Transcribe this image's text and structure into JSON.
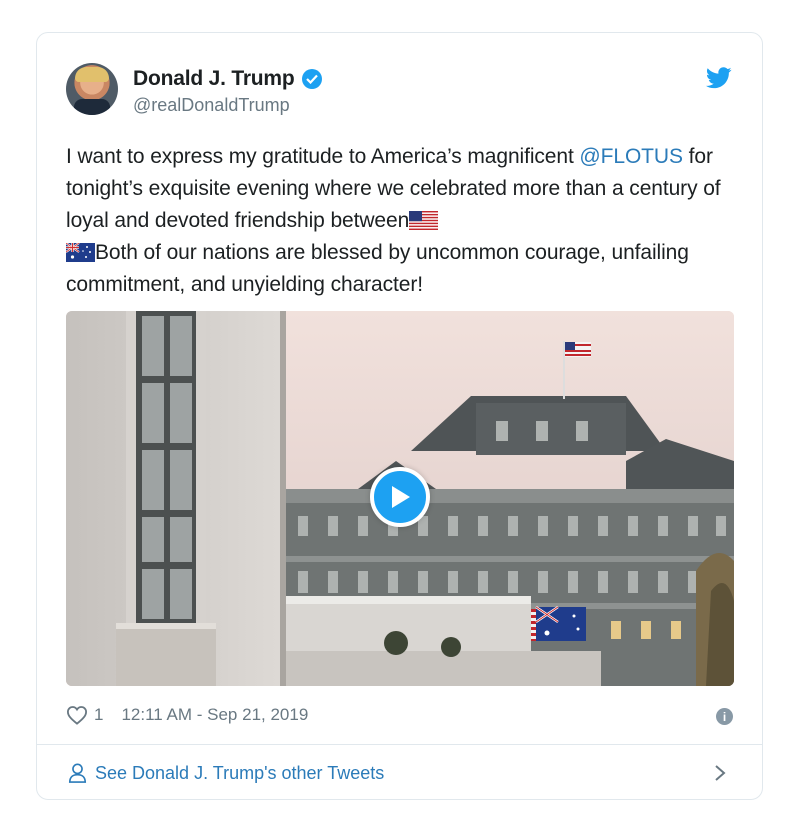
{
  "author": {
    "display_name": "Donald J. Trump",
    "handle": "@realDonaldTrump",
    "verified": true
  },
  "tweet": {
    "text_part1": "I want to express my gratitude to America’s magnificent ",
    "mention": "@FLOTUS",
    "text_part2": " for tonight’s exquisite evening where we celebrated more than a century of loyal and devoted friendship between",
    "flag_us": "us-flag-emoji",
    "flag_au": "australia-flag-emoji",
    "text_part3": "Both of our nations are blessed by uncommon courage, unfailing commitment, and unyielding character!"
  },
  "media": {
    "type": "video",
    "play_icon": "play-icon"
  },
  "meta": {
    "like_count": "1",
    "timestamp": "12:11 AM - Sep 21, 2019",
    "info_icon": "i"
  },
  "footer": {
    "other_tweets_label": "See Donald J. Trump's other Tweets"
  },
  "colors": {
    "accent": "#1da1f2",
    "link": "#2b7bb9",
    "secondary_text": "#697882",
    "border": "#e1e8ed"
  }
}
